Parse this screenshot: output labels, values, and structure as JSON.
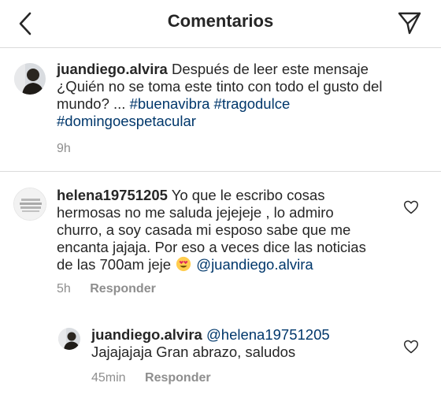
{
  "header": {
    "title": "Comentarios",
    "back_icon": "chevron-left-icon",
    "send_icon": "paper-plane-icon"
  },
  "caption": {
    "username": "juandiego.alvira",
    "text_line1": " Después de leer este mensaje",
    "text_line2": "¿Quién no se toma este tinto con todo el gusto del",
    "text_line3": "mundo? ... ",
    "hashtag1": "#buenavibra",
    "hashtag2": "#tragodulce",
    "hashtag3": "#domingoespetacular",
    "time": "9h"
  },
  "comments": [
    {
      "username": "helena19751205",
      "line1": " Yo que le escribo cosas",
      "line2": "hermosas no me saluda jejejeje , lo admiro",
      "line3": "churro, a soy casada mi esposo sabe que me",
      "line4": "encanta jajaja. Por eso a veces dice las noticias",
      "line5": "de las 700am jeje ",
      "emoji": "heart-eyes-emoji",
      "mention": "@juandiego.alvira",
      "time": "5h",
      "reply_label": "Responder"
    }
  ],
  "replies": [
    {
      "username": "juandiego.alvira",
      "mention": "@helena19751205",
      "line2": "Jajajajaja Gran abrazo, saludos",
      "time": "45min",
      "reply_label": "Responder"
    }
  ]
}
